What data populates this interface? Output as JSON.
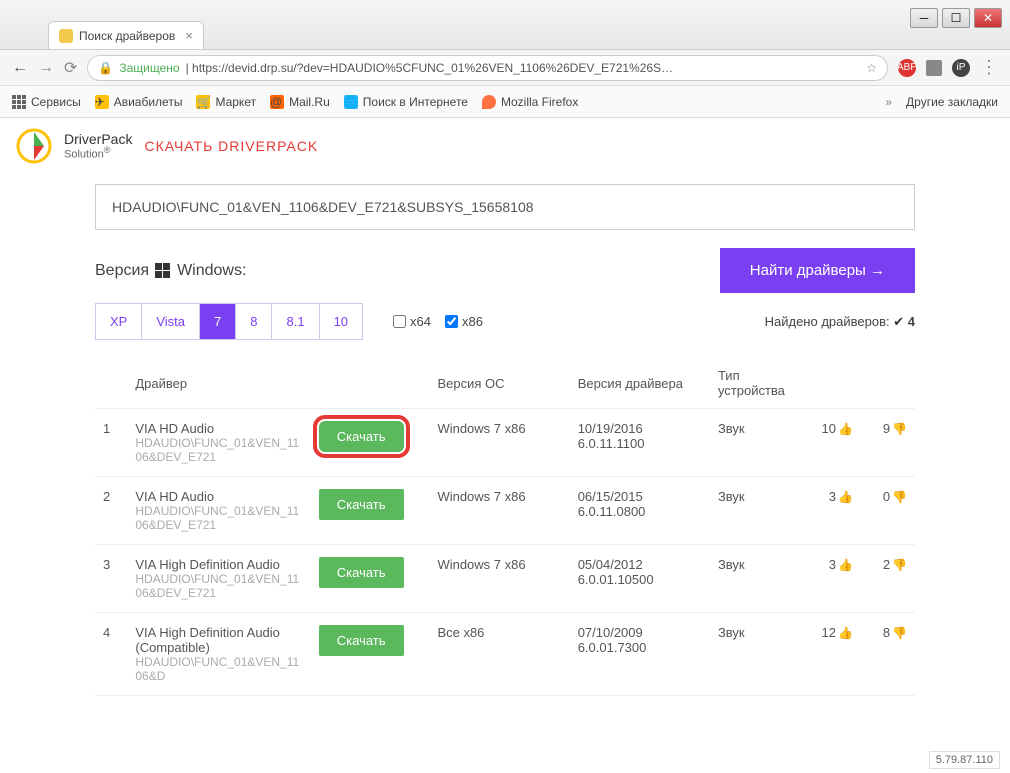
{
  "window": {
    "tab_title": "Поиск драйверов"
  },
  "addr": {
    "secure_label": "Защищено",
    "url": "https://devid.drp.su/?dev=HDAUDIO%5CFUNC_01%26VEN_1106%26DEV_E721%26S…"
  },
  "bookmarks": {
    "apps": "Сервисы",
    "avia": "Авиабилеты",
    "market": "Маркет",
    "mail": "Mail.Ru",
    "search": "Поиск в Интернете",
    "firefox": "Mozilla Firefox",
    "other": "Другие закладки"
  },
  "header": {
    "brand1": "DriverPack",
    "brand2": "Solution",
    "download_link": "СКАЧАТЬ DRIVERPACK"
  },
  "search_value": "HDAUDIO\\FUNC_01&VEN_1106&DEV_E721&SUBSYS_15658108",
  "version": {
    "label": "Версия",
    "windows": "Windows:"
  },
  "find_button": "Найти драйверы →",
  "os_tabs": [
    "XP",
    "Vista",
    "7",
    "8",
    "8.1",
    "10"
  ],
  "arch": {
    "x64": "x64",
    "x86": "x86"
  },
  "found": {
    "label": "Найдено драйверов:",
    "count": "4"
  },
  "table_headers": {
    "driver": "Драйвер",
    "os": "Версия ОС",
    "driver_ver": "Версия драйвера",
    "type": "Тип устройства"
  },
  "dl_label": "Скачать",
  "rows": [
    {
      "n": "1",
      "name": "VIA HD Audio",
      "path": "HDAUDIO\\FUNC_01&VEN_1106&DEV_E721",
      "os": "Windows 7 x86",
      "date": "10/19/2016",
      "ver": "6.0.11.1100",
      "type": "Звук",
      "like": "10",
      "dis": "9"
    },
    {
      "n": "2",
      "name": "VIA HD Audio",
      "path": "HDAUDIO\\FUNC_01&VEN_1106&DEV_E721",
      "os": "Windows 7 x86",
      "date": "06/15/2015",
      "ver": "6.0.11.0800",
      "type": "Звук",
      "like": "3",
      "dis": "0"
    },
    {
      "n": "3",
      "name": "VIA High Definition Audio",
      "path": "HDAUDIO\\FUNC_01&VEN_1106&DEV_E721",
      "os": "Windows 7 x86",
      "date": "05/04/2012",
      "ver": "6.0.01.10500",
      "type": "Звук",
      "like": "3",
      "dis": "2"
    },
    {
      "n": "4",
      "name": "VIA High Definition Audio (Compatible)",
      "path": "HDAUDIO\\FUNC_01&VEN_1106&D",
      "os": "Все x86",
      "date": "07/10/2009",
      "ver": "6.0.01.7300",
      "type": "Звук",
      "like": "12",
      "dis": "8"
    }
  ],
  "ip_badge": "5.79.87.110"
}
